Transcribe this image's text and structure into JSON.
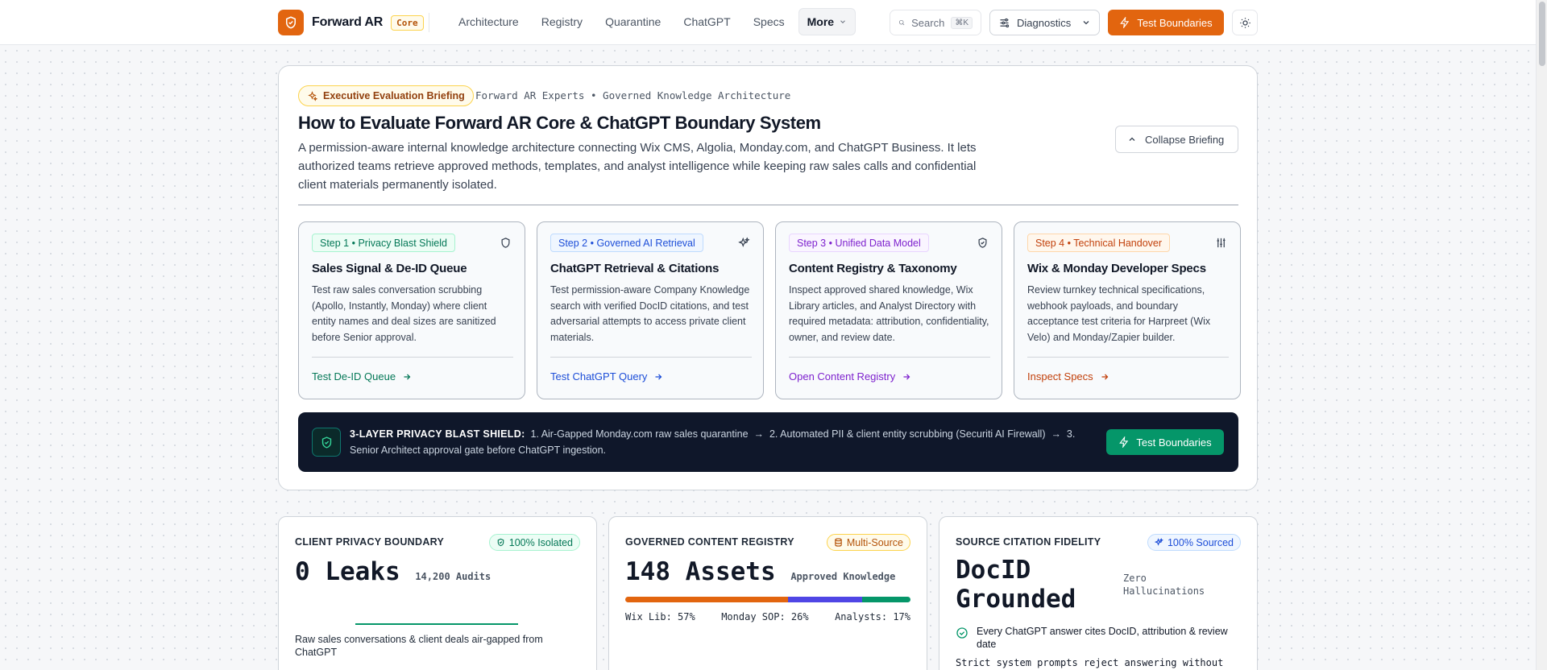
{
  "header": {
    "brand_name": "Forward AR",
    "brand_badge": "Core",
    "nav": [
      "Architecture",
      "Registry",
      "Quarantine",
      "ChatGPT",
      "Specs"
    ],
    "more_label": "More",
    "search_label": "Search",
    "search_shortcut": "⌘K",
    "diagnostics_label": "Diagnostics",
    "test_button": "Test Boundaries",
    "accent": "#e2650f"
  },
  "briefing": {
    "badge": "Executive Evaluation Briefing",
    "subtitle": "Forward AR Experts • Governed Knowledge Architecture",
    "title": "How to Evaluate Forward AR Core & ChatGPT Boundary System",
    "description": "A permission-aware internal knowledge architecture connecting Wix CMS, Algolia, Monday.com, and ChatGPT Business. It lets authorized teams retrieve approved methods, templates, and analyst intelligence while keeping raw sales calls and confidential client materials permanently isolated.",
    "collapse_label": "Collapse Briefing",
    "steps": [
      {
        "badge": "Step 1 • Privacy Blast Shield",
        "title": "Sales Signal & De-ID Queue",
        "description": "Test raw sales conversation scrubbing (Apollo, Instantly, Monday) where client entity names and deal sizes are sanitized before Senior approval.",
        "link": "Test De-ID Queue",
        "icon": "shield-icon",
        "color": "#047857"
      },
      {
        "badge": "Step 2 • Governed AI Retrieval",
        "title": "ChatGPT Retrieval & Citations",
        "description": "Test permission-aware Company Knowledge search with verified DocID citations, and test adversarial attempts to access private client materials.",
        "link": "Test ChatGPT Query",
        "icon": "sparkles-icon",
        "color": "#1d4ed8"
      },
      {
        "badge": "Step 3 • Unified Data Model",
        "title": "Content Registry & Taxonomy",
        "description": "Inspect approved shared knowledge, Wix Library articles, and Analyst Directory with required metadata: attribution, confidentiality, owner, and review date.",
        "link": "Open Content Registry",
        "icon": "shield-check-icon",
        "color": "#7e22ce"
      },
      {
        "badge": "Step 4 • Technical Handover",
        "title": "Wix & Monday Developer Specs",
        "description": "Review turnkey technical specifications, webhook payloads, and boundary acceptance test criteria for Harpreet (Wix Velo) and Monday/Zapier builder.",
        "link": "Inspect Specs",
        "icon": "sliders-icon",
        "color": "#c2410c"
      }
    ],
    "shield": {
      "heading": "3-LAYER PRIVACY BLAST SHIELD:",
      "layer1": "1. Air-Gapped Monday.com raw sales quarantine",
      "layer2": "2. Automated PII & client entity scrubbing (Securiti AI Firewall)",
      "layer3": "3. Senior Architect approval gate before ChatGPT ingestion.",
      "button": "Test Boundaries"
    }
  },
  "metrics": [
    {
      "label": "CLIENT PRIVACY BOUNDARY",
      "pill": "100% Isolated",
      "value": "0 Leaks",
      "value_sub": "14,200 Audits",
      "footer": "Raw sales conversations & client deals air-gapped from ChatGPT"
    },
    {
      "label": "GOVERNED CONTENT REGISTRY",
      "pill": "Multi-Source",
      "value": "148 Assets",
      "value_sub": "Approved Knowledge",
      "segments": [
        {
          "label": "Wix Lib: 57%",
          "share": 57,
          "color": "#e2650f"
        },
        {
          "label": "Monday SOP: 26%",
          "share": 26,
          "color": "#4f46e5"
        },
        {
          "label": "Analysts: 17%",
          "share": 17,
          "color": "#059669"
        }
      ]
    },
    {
      "label": "SOURCE CITATION FIDELITY",
      "pill": "100% Sourced",
      "value": "DocID Grounded",
      "value_sub": "Zero Hallucinations",
      "check_text": "Every ChatGPT answer cites DocID, attribution & review date",
      "note": "Strict system prompts reject answering without"
    }
  ]
}
